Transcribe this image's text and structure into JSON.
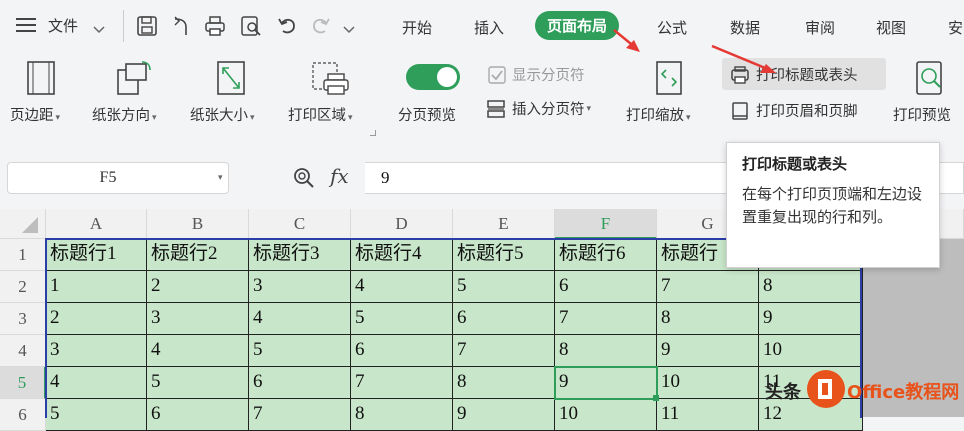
{
  "menubar": {
    "file_label": "文件",
    "tabs": [
      "开始",
      "插入",
      "页面布局",
      "公式",
      "数据",
      "审阅",
      "视图",
      "安"
    ]
  },
  "ribbon": {
    "margins": "页边距",
    "orientation": "纸张方向",
    "size": "纸张大小",
    "print_area": "打印区域",
    "page_break_preview": "分页预览",
    "show_page_breaks": "显示分页符",
    "insert_page_break": "插入分页符",
    "print_scale": "打印缩放",
    "print_titles": "打印标题或表头",
    "header_footer": "打印页眉和页脚",
    "print_preview": "打印预览",
    "page_break_toggle_on": true
  },
  "formula": {
    "cell_ref": "F5",
    "fx": "fx",
    "value": "9"
  },
  "columns": [
    "A",
    "B",
    "C",
    "D",
    "E",
    "F",
    "G"
  ],
  "rows": [
    "1",
    "2",
    "3",
    "4",
    "5",
    "6"
  ],
  "cells": [
    [
      "标题行1",
      "标题行2",
      "标题行3",
      "标题行4",
      "标题行5",
      "标题行6",
      "标题行",
      ""
    ],
    [
      "1",
      "2",
      "3",
      "4",
      "5",
      "6",
      "7",
      "8"
    ],
    [
      "2",
      "3",
      "4",
      "5",
      "6",
      "7",
      "8",
      "9"
    ],
    [
      "3",
      "4",
      "5",
      "6",
      "7",
      "8",
      "9",
      "10"
    ],
    [
      "4",
      "5",
      "6",
      "7",
      "8",
      "9",
      "10",
      "11"
    ],
    [
      "5",
      "6",
      "7",
      "8",
      "9",
      "10",
      "11",
      "12"
    ]
  ],
  "tooltip": {
    "title": "打印标题或表头",
    "desc": "在每个打印页顶端和左边设置重复出现的行和列。"
  },
  "watermark": {
    "prefix": "头条",
    "brand": "Office教程网"
  },
  "colors": {
    "accent": "#2e9e5a",
    "cell_fill": "#c8e6c9",
    "arrow": "#e53935"
  }
}
